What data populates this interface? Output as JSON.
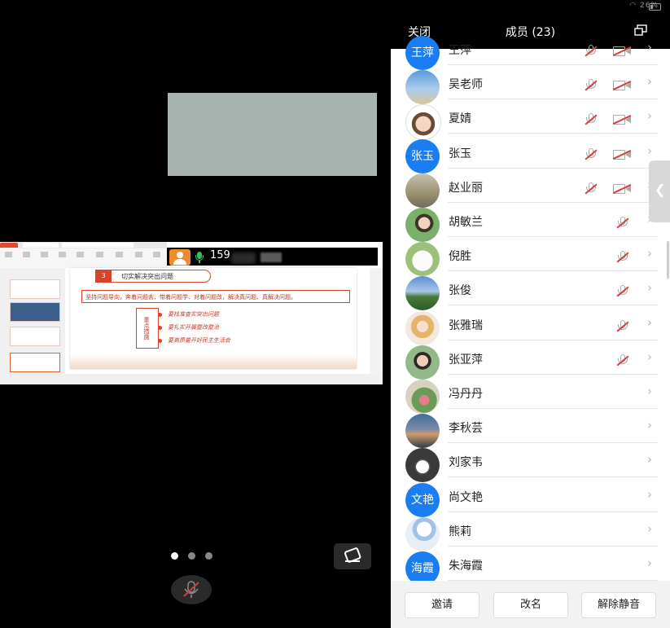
{
  "screen": {
    "share_bar": {
      "name_part": "159"
    },
    "slide": {
      "number": "3",
      "title": "切实解决突出问题",
      "banner": "坚持问题导向，奔着问题去、带着问题学、对着问题改，解决真问题、真解决问题。",
      "box": "重点措施",
      "items": [
        "要找准查实突出问题",
        "要扎实开展整改整治",
        "要高质量开好民主生活会"
      ]
    },
    "page_dots": 3,
    "active_dot": 0
  },
  "panel": {
    "status_bar": {
      "battery": "26%"
    },
    "header": {
      "close_label": "关闭",
      "title": "成员 (23)"
    },
    "members": [
      {
        "name": "王萍",
        "avatar_text": "王萍",
        "avatar_style": "text",
        "mic_muted": true,
        "camera_off": true
      },
      {
        "name": "吴老师",
        "avatar_style": "sky",
        "mic_muted": true,
        "camera_off": true
      },
      {
        "name": "夏婧",
        "avatar_style": "cartoon-girl",
        "mic_muted": true,
        "camera_off": true
      },
      {
        "name": "张玉",
        "avatar_text": "张玉",
        "avatar_style": "text",
        "mic_muted": true,
        "camera_off": true
      },
      {
        "name": "赵业丽",
        "avatar_style": "interior",
        "mic_muted": true,
        "camera_off": true
      },
      {
        "name": "胡敏兰",
        "avatar_style": "portrait-green",
        "mic_muted": true,
        "camera_off": false
      },
      {
        "name": "倪胜",
        "avatar_style": "white-dog",
        "mic_muted": true,
        "camera_off": false
      },
      {
        "name": "张俊",
        "avatar_style": "landscape",
        "mic_muted": true,
        "camera_off": false
      },
      {
        "name": "张雅瑞",
        "avatar_style": "doll",
        "mic_muted": true,
        "camera_off": false
      },
      {
        "name": "张亚萍",
        "avatar_style": "portrait-outdoor",
        "mic_muted": true,
        "camera_off": false
      },
      {
        "name": "冯丹丹",
        "avatar_style": "flower",
        "mic_muted": false,
        "camera_off": false
      },
      {
        "name": "李秋芸",
        "avatar_style": "dusk",
        "mic_muted": false,
        "camera_off": false
      },
      {
        "name": "刘家韦",
        "avatar_style": "cartoon-face",
        "mic_muted": false,
        "camera_off": false
      },
      {
        "name": "尚文艳",
        "avatar_text": "文艳",
        "avatar_style": "text",
        "mic_muted": false,
        "camera_off": false
      },
      {
        "name": "熊莉",
        "avatar_style": "girl-umbrella",
        "mic_muted": false,
        "camera_off": false
      },
      {
        "name": "朱海霞",
        "avatar_text": "海霞",
        "avatar_style": "text",
        "mic_muted": false,
        "camera_off": false
      }
    ],
    "footer": {
      "invite_label": "邀请",
      "rename_label": "改名",
      "unmute_label": "解除静音"
    },
    "colors": {
      "accent_blue": "#1a7df1",
      "slide_red": "#d9432a",
      "mic_green": "#33c05a",
      "mute_red": "#d04040"
    }
  }
}
